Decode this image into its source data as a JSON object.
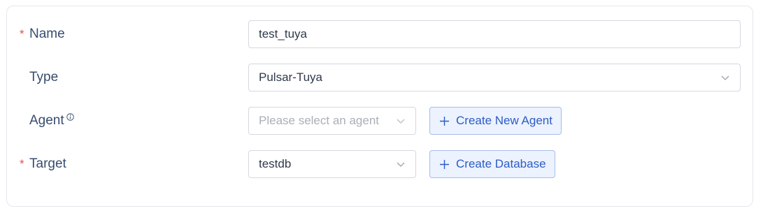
{
  "form": {
    "name": {
      "label": "Name",
      "required_mark": "*",
      "value": "test_tuya"
    },
    "type": {
      "label": "Type",
      "value": "Pulsar-Tuya"
    },
    "agent": {
      "label": "Agent",
      "placeholder": "Please select an agent",
      "create_button": "Create New Agent"
    },
    "target": {
      "label": "Target",
      "required_mark": "*",
      "value": "testdb",
      "create_button": "Create Database"
    }
  },
  "icons": {
    "info": "info-circle-icon",
    "chevron": "chevron-down-icon",
    "plus": "plus-icon"
  },
  "colors": {
    "label": "#374d6f",
    "required": "#f04b4b",
    "accent": "#2c5cc5",
    "accent_bg": "#ecf2fe",
    "border": "#d4d8df",
    "placeholder": "#a9afb8"
  }
}
